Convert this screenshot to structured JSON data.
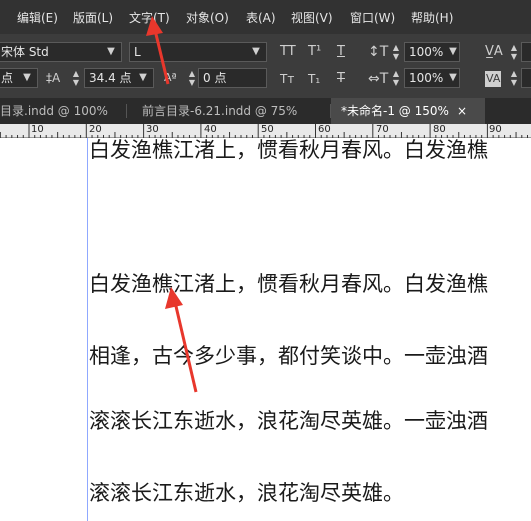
{
  "menu": {
    "items": [
      "编辑(E)",
      "版面(L)",
      "文字(T)",
      "对象(O)",
      "表(A)",
      "视图(V)",
      "窗口(W)",
      "帮助(H)"
    ]
  },
  "control_panel": {
    "font_family": "宋体 Std",
    "font_style": "L",
    "point_unit": "点",
    "leading": "34.4 点",
    "baseline_shift": "0 点",
    "horizontal_scale": "100%",
    "vertical_scale": "100%",
    "type_case_icons": [
      "all-caps-icon",
      "superscript-icon",
      "underline-icon",
      "small-caps-icon",
      "subscript-icon",
      "strikethrough-icon"
    ],
    "icon_glyphs": {
      "all_caps": "TT",
      "superscript": "T¹",
      "underline": "T",
      "small_caps": "Tт",
      "subscript": "T₁",
      "strikethrough": "T"
    }
  },
  "tabs": [
    {
      "label": "目录.indd @ 100%",
      "active": false
    },
    {
      "label": "前言目录-6.21.indd @ 75%",
      "active": false
    },
    {
      "label": "*未命名-1 @ 150%",
      "active": true
    }
  ],
  "ruler": {
    "labels": [
      "10",
      "20",
      "30",
      "40",
      "50",
      "60",
      "70",
      "80",
      "90"
    ]
  },
  "document": {
    "lines": [
      "白发渔樵江渚上，惯看秋月春风。白发渔樵",
      "白发渔樵江渚上，惯看秋月春风。白发渔樵",
      "相逢，古今多少事，都付笑谈中。一壶浊酒",
      "滚滚长江东逝水，浪花淘尽英雄。一壶浊酒",
      "滚滚长江东逝水，浪花淘尽英雄。"
    ]
  },
  "colors": {
    "menubar": "#323232",
    "toolbar": "#3c3c3c",
    "tabbar": "#2b2b2b",
    "active_tab": "#4a4a4a",
    "margin_guide": "#8fa8ff",
    "annotation_arrow": "#e8372c"
  }
}
